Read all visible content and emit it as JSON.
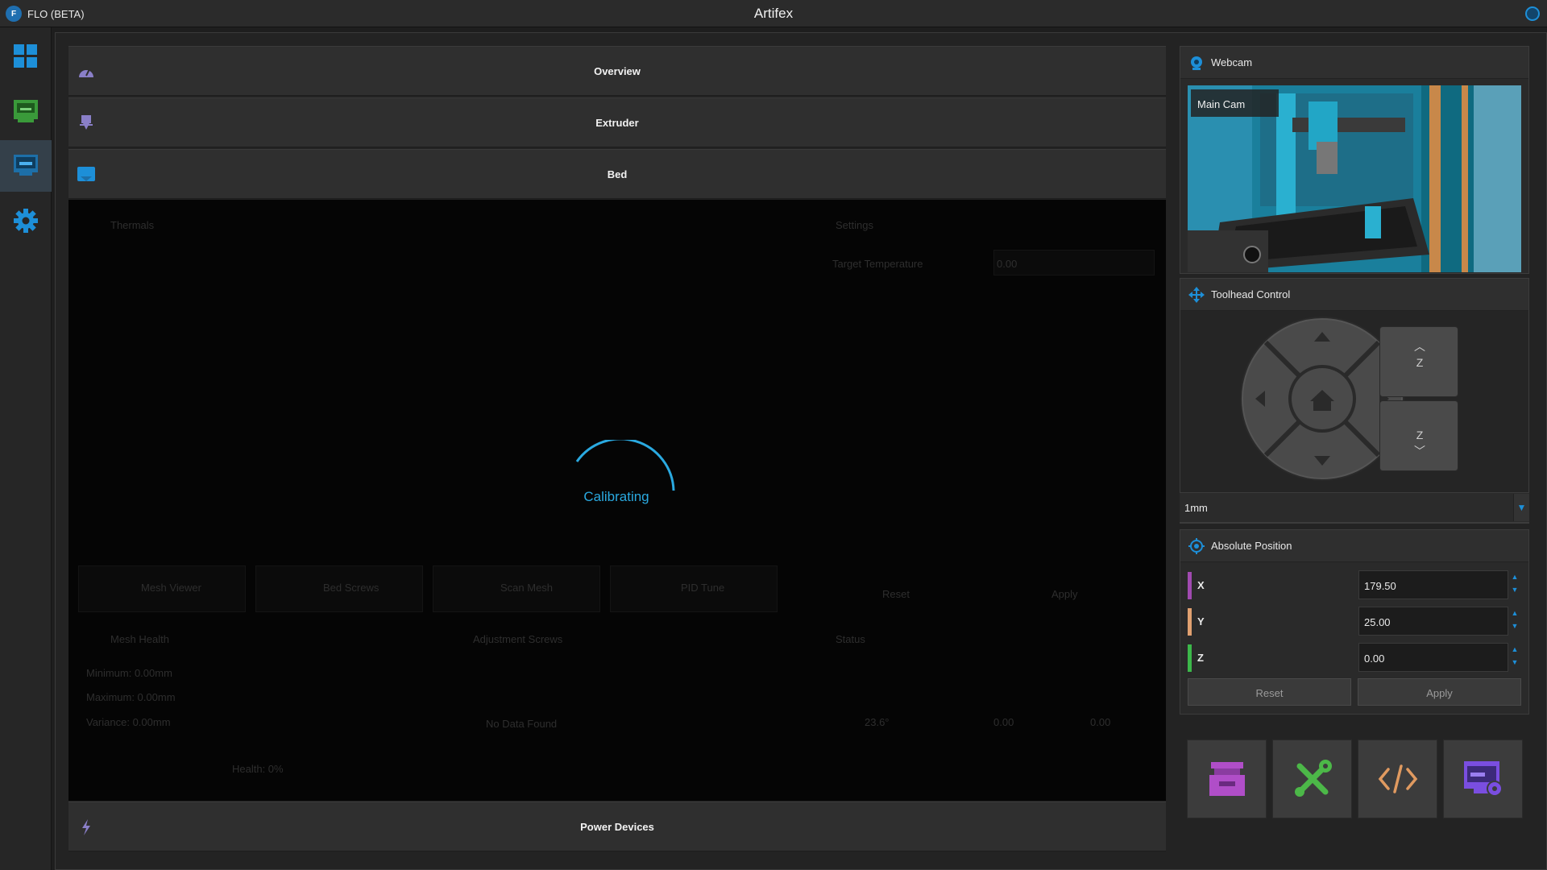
{
  "titlebar": {
    "app_name": "FLO (BETA)",
    "window_title": "Artifex",
    "logo_text": "F"
  },
  "sidebar": {
    "items": [
      {
        "name": "dashboard",
        "icon": "grid-icon",
        "active": false
      },
      {
        "name": "printer",
        "icon": "printer-screen-icon",
        "active": false
      },
      {
        "name": "control",
        "icon": "monitor-icon",
        "active": true
      },
      {
        "name": "settings",
        "icon": "gear-icon",
        "active": false
      }
    ]
  },
  "accordion": {
    "overview": "Overview",
    "extruder": "Extruder",
    "bed": "Bed",
    "power_devices": "Power Devices"
  },
  "bed": {
    "thermals": "Thermals",
    "settings": "Settings",
    "target_temperature_label": "Target Temperature",
    "target_temperature_value": "0.00",
    "tools": [
      "Mesh Viewer",
      "Bed Screws",
      "Scan Mesh",
      "PID Tune"
    ],
    "right_tools": [
      "Reset",
      "Apply"
    ],
    "mesh_health": "Mesh Health",
    "minimum": "Minimum: 0.00mm",
    "maximum": "Maximum: 0.00mm",
    "variance": "Variance: 0.00mm",
    "health": "Health: 0%",
    "adjustment_screws": "Adjustment Screws",
    "no_data": "No Data Found",
    "status": "Status",
    "gauge_main": "23.6°",
    "gauge_2": "0.00",
    "gauge_3": "0.00",
    "overlay_text": "Calibrating"
  },
  "webcam": {
    "title": "Webcam",
    "camera_name": "Main Cam"
  },
  "toolhead": {
    "title": "Toolhead Control",
    "z_label": "Z",
    "step": "1mm"
  },
  "position": {
    "title": "Absolute Position",
    "axes": [
      {
        "label": "X",
        "value": "179.50",
        "color": "#a04ab0"
      },
      {
        "label": "Y",
        "value": "25.00",
        "color": "#e0a070"
      },
      {
        "label": "Z",
        "value": "0.00",
        "color": "#3cb84a"
      }
    ],
    "reset_label": "Reset",
    "apply_label": "Apply"
  },
  "shortcuts": [
    {
      "name": "file-manager",
      "icon": "archive-drawer-icon",
      "color": "#b04ec8"
    },
    {
      "name": "tools",
      "icon": "wrench-screwdriver-icon",
      "color": "#4cb848"
    },
    {
      "name": "console",
      "icon": "code-icon",
      "color": "#e09a60"
    },
    {
      "name": "printer-settings",
      "icon": "monitor-gear-icon",
      "color": "#7a4ee0"
    }
  ],
  "colors": {
    "accent": "#1d8fd8",
    "spinner": "#2aa9e0"
  }
}
